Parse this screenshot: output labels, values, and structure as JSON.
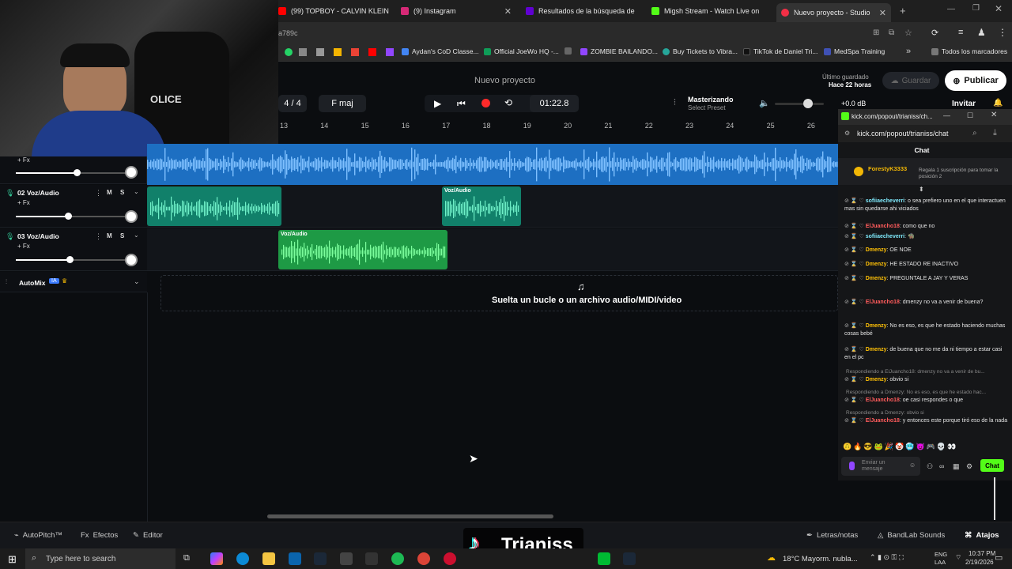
{
  "browser": {
    "tabs": [
      {
        "label": "(99) TOPBOY - CALVIN KLEIN (",
        "color": "#ff0000"
      },
      {
        "label": "(9) Instagram",
        "color": "#d62976"
      },
      {
        "label": "Resultados de la búsqueda de",
        "color": "#6001d2"
      },
      {
        "label": "Migsh Stream - Watch Live on",
        "color": "#53fc18"
      },
      {
        "label": "Nuevo proyecto - Studio",
        "color": "#f22f46"
      }
    ],
    "url_fragment": "a789c",
    "bookmarks": [
      {
        "label": "Aydan's CoD Classe...",
        "color": "#4285f4"
      },
      {
        "label": "Official JoeWo HQ -...",
        "color": "#0f9d58"
      },
      {
        "label": "ZOMBIE BAILANDO...",
        "color": "#9146ff"
      },
      {
        "label": "Buy Tickets to Vibra...",
        "color": "#26a69a"
      },
      {
        "label": "TikTok de Daniel Tri...",
        "color": "#000000"
      },
      {
        "label": "MedSpa Training",
        "color": "#3f51b5"
      }
    ],
    "bookmarks_folder": "Todos los marcadores"
  },
  "studio": {
    "project_title": "Nuevo proyecto",
    "saved_label": "Último guardado",
    "saved_time": "Hace 22 horas",
    "save_button": "Guardar",
    "publish_button": "Publicar",
    "invite_button": "Invitar",
    "time_signature": "4 / 4",
    "key": "F maj",
    "time_display": "01:22.8",
    "mastering_label": "Masterizando",
    "mastering_preset": "Select Preset",
    "volume_db": "+0.0 dB",
    "ruler": [
      "13",
      "14",
      "15",
      "16",
      "17",
      "18",
      "19",
      "20",
      "21",
      "22",
      "23",
      "24",
      "25",
      "26"
    ],
    "drop_hint": "Suelta un bucle o un archivo audio/MIDI/video",
    "tracks": [
      {
        "name": "02 Voz/Audio",
        "fx": "+ Fx",
        "mute": "M",
        "solo": "S",
        "volume": 0.6
      },
      {
        "name": "03 Voz/Audio",
        "fx": "+ Fx",
        "mute": "M",
        "solo": "S",
        "volume": 0.6
      }
    ],
    "top_track_fx": "+ Fx",
    "clip_label": "Voz/Audio",
    "automix": "AutoMix",
    "automix_badge": "IA",
    "bottom": {
      "autopitch": "AutoPitch™",
      "effects": "Efectos",
      "editor": "Editor",
      "lyrics": "Letras/notas",
      "sounds": "BandLab Sounds",
      "shortcuts": "Atajos"
    }
  },
  "chat": {
    "popup_url": "kick.com/popout/trianiss/ch...",
    "address": "kick.com/popout/trianiss/chat",
    "header": "Chat",
    "pinned_user": "ForestyK3333",
    "pinned_text": "Regala 1 suscripción para tomar la posición 2",
    "messages": [
      {
        "user": "sofiiaecheverri",
        "text": ": o sea prefiero uno en el que interactuen mas sin quedarse ahi viciados",
        "color": "#7ee8fa"
      },
      {
        "user": "ElJuancho18",
        "text": ": como que no",
        "color": "#ff5c5c"
      },
      {
        "user": "sofiiaecheverri",
        "text": ": 🧌",
        "color": "#7ee8fa"
      },
      {
        "user": "Dmenzy",
        "text": ": OE NOE",
        "color": "#ffc107"
      },
      {
        "user": "Dmenzy",
        "text": ": HE ESTADO RE INACTIVO",
        "color": "#ffc107"
      },
      {
        "user": "Dmenzy",
        "text": ": PREGUNTALE A JAY Y VERAS",
        "color": "#ffc107"
      },
      {
        "user": "ElJuancho18",
        "text": ": dmenzy no va a venir de buena?",
        "color": "#ff5c5c"
      },
      {
        "user": "Dmenzy",
        "text": ": No es eso, es que he estado haciendo muchas cosas bebé",
        "color": "#ffc107"
      },
      {
        "user": "Dmenzy",
        "text": ": de buena que no me da ni tiempo a estar casi en el pc",
        "color": "#ffc107"
      },
      {
        "user": "Dmenzy",
        "text": ": obvio si",
        "color": "#ffc107"
      },
      {
        "user": "ElJuancho18",
        "text": ": oe casi respondes o que",
        "color": "#ff5c5c"
      },
      {
        "user": "ElJuancho18",
        "text": ": y entonces este porque tiró eso de la nada",
        "color": "#ff5c5c"
      }
    ],
    "replies": [
      "Respondiendo a ElJuancho18: dmenzy no va a venir de bu...",
      "Respondiendo a Dmenzy: No es eso, es que he estado hac...",
      "Respondiendo a Dmenzy: obvio si"
    ],
    "input_placeholder": "Enviar un mensaje",
    "send_button": "Chat"
  },
  "overlay": {
    "brand": "Trianiss"
  },
  "taskbar": {
    "search_placeholder": "Type here to search",
    "weather": "18°C  Mayorm. nubla...",
    "lang": "ENG",
    "region": "LAA",
    "time": "10:37 PM",
    "date": "2/19/2026"
  }
}
